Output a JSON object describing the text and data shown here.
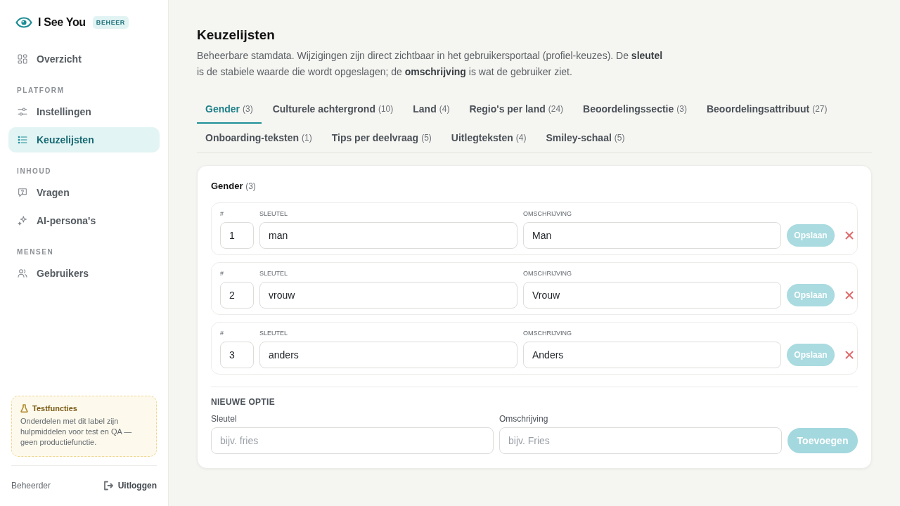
{
  "sidebar": {
    "brand": {
      "name": "I See You",
      "badge": "BEHEER"
    },
    "sections": [
      {
        "items": [
          {
            "label": "Overzicht",
            "selected": false
          }
        ]
      },
      {
        "heading": "PLATFORM",
        "items": [
          {
            "label": "Instellingen",
            "selected": false
          },
          {
            "label": "Keuzelijsten",
            "selected": true
          }
        ]
      },
      {
        "heading": "INHOUD",
        "items": [
          {
            "label": "Vragen",
            "selected": false
          },
          {
            "label": "AI-persona's",
            "selected": false
          }
        ]
      },
      {
        "heading": "MENSEN",
        "items": [
          {
            "label": "Gebruikers",
            "selected": false
          }
        ]
      }
    ],
    "notice": {
      "title": "Testfuncties",
      "text": "Onderdelen met dit label zijn hulpmiddelen voor test en QA — geen productiefunctie."
    },
    "footer": {
      "user": "Beheerder",
      "logout": "Uitloggen"
    }
  },
  "page": {
    "title": "Keuzelijsten",
    "description": "Beheerbare stamdata. Wijzigingen zijn direct zichtbaar in het gebruikersportaal (profiel-keuzes). De **sleutel** is de stabiele waarde die wordt opgeslagen; de **omschrijving** is wat de gebruiker ziet."
  },
  "tabs": [
    {
      "label": "Gender",
      "count": "(3)",
      "selected": true
    },
    {
      "label": "Culturele achtergrond",
      "count": "(10)",
      "selected": false
    },
    {
      "label": "Land",
      "count": "(4)",
      "selected": false
    },
    {
      "label": "Regio's per land",
      "count": "(24)",
      "selected": false
    },
    {
      "label": "Beoordelingssectie",
      "count": "(3)",
      "selected": false
    },
    {
      "label": "Beoordelingsattribuut",
      "count": "(27)",
      "selected": false
    },
    {
      "label": "Onboarding-teksten",
      "count": "(1)",
      "selected": false
    },
    {
      "label": "Tips per deelvraag",
      "count": "(5)",
      "selected": false
    },
    {
      "label": "Uitlegteksten",
      "count": "(4)",
      "selected": false
    },
    {
      "label": "Smiley-schaal",
      "count": "(5)",
      "selected": false
    }
  ],
  "list": {
    "title": "Gender",
    "count": "(3)",
    "rows": [
      {
        "number_label": "#",
        "key_label": "SLEUTEL",
        "description_label": "OMSCHRIJVING",
        "number": "1",
        "key": "man",
        "description": "Man",
        "save": {
          "label": "Opslaan",
          "disabled": true
        }
      },
      {
        "number_label": "#",
        "key_label": "SLEUTEL",
        "description_label": "OMSCHRIJVING",
        "number": "2",
        "key": "vrouw",
        "description": "Vrouw",
        "save": {
          "label": "Opslaan",
          "disabled": true
        }
      },
      {
        "number_label": "#",
        "key_label": "SLEUTEL",
        "description_label": "OMSCHRIJVING",
        "number": "3",
        "key": "anders",
        "description": "Anders",
        "save": {
          "label": "Opslaan",
          "disabled": true
        }
      }
    ],
    "new_option": {
      "heading": "NIEUWE OPTIE",
      "key_label": "Sleutel",
      "key_placeholder": "bijv. fries",
      "description_label": "Omschrijving",
      "description_placeholder": "bijv. Fries",
      "add": {
        "label": "Toevoegen",
        "disabled": true
      }
    }
  }
}
